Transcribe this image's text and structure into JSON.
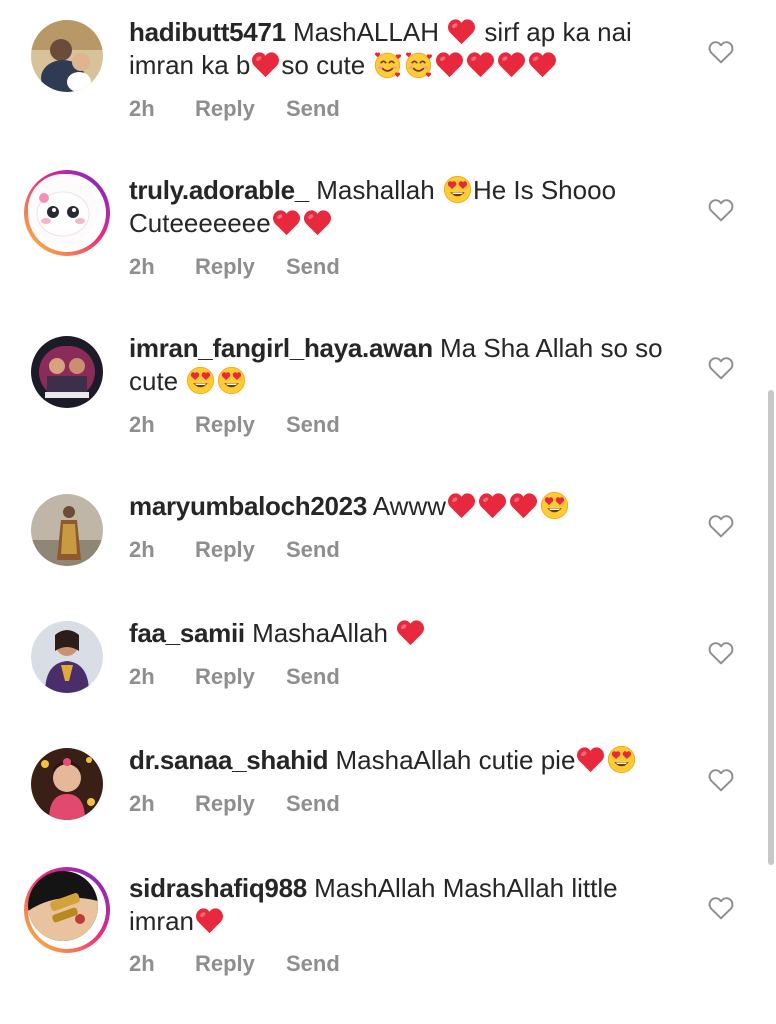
{
  "comments": [
    {
      "username": "hadibutt5471",
      "parts": [
        {
          "t": "MashALLAH "
        },
        {
          "e": "red-heart"
        },
        {
          "t": " sirf ap ka nai imran ka b"
        },
        {
          "e": "red-heart"
        },
        {
          "t": "so cute "
        },
        {
          "e": "smiling-face-with-hearts"
        },
        {
          "e": "smiling-face-with-hearts"
        },
        {
          "e": "red-heart"
        },
        {
          "e": "red-heart"
        },
        {
          "e": "red-heart"
        },
        {
          "e": "red-heart"
        }
      ],
      "time": "2h",
      "reply": "Reply",
      "send": "Send"
    },
    {
      "username": "truly.adorable_",
      "parts": [
        {
          "t": "Mashallah "
        },
        {
          "e": "heart-eyes"
        },
        {
          "t": "He Is Shooo Cuteeeeeee"
        },
        {
          "e": "red-heart"
        },
        {
          "e": "red-heart"
        }
      ],
      "time": "2h",
      "reply": "Reply",
      "send": "Send"
    },
    {
      "username": "imran_fangirl_haya.awan",
      "parts": [
        {
          "t": "Ma Sha Allah so so cute "
        },
        {
          "e": "heart-eyes"
        },
        {
          "e": "heart-eyes"
        }
      ],
      "time": "2h",
      "reply": "Reply",
      "send": "Send"
    },
    {
      "username": "maryumbaloch2023",
      "parts": [
        {
          "t": "Awww"
        },
        {
          "e": "red-heart"
        },
        {
          "e": "red-heart"
        },
        {
          "e": "red-heart"
        },
        {
          "e": "heart-eyes"
        }
      ],
      "time": "2h",
      "reply": "Reply",
      "send": "Send"
    },
    {
      "username": "faa_samii",
      "parts": [
        {
          "t": "MashaAllah "
        },
        {
          "e": "red-heart"
        }
      ],
      "time": "2h",
      "reply": "Reply",
      "send": "Send"
    },
    {
      "username": "dr.sanaa_shahid",
      "parts": [
        {
          "t": "MashaAllah cutie pie"
        },
        {
          "e": "red-heart"
        },
        {
          "e": "heart-eyes"
        }
      ],
      "time": "2h",
      "reply": "Reply",
      "send": "Send"
    },
    {
      "username": "sidrashafiq988",
      "parts": [
        {
          "t": "MashAllah MashAllah little imran"
        },
        {
          "e": "red-heart"
        }
      ],
      "time": "2h",
      "reply": "Reply",
      "send": "Send"
    }
  ],
  "icons": {
    "like": "heart-outline-icon",
    "red-heart": "red-heart-emoji",
    "heart-eyes": "smiling-face-with-heart-eyes-emoji",
    "smiling-face-with-hearts": "smiling-face-with-hearts-emoji"
  },
  "colors": {
    "text": "#262626",
    "meta": "#8e8e8e",
    "heart": "#e8283c",
    "emoji_face": "#ffcc33"
  }
}
